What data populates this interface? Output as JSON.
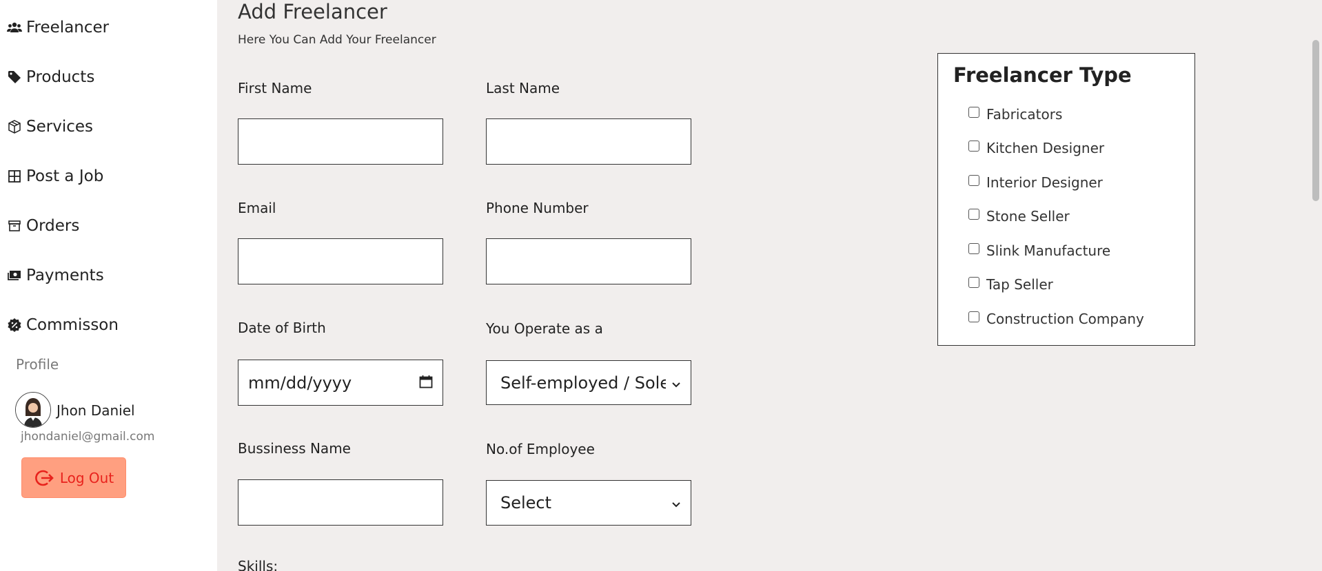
{
  "sidebar": {
    "items": [
      {
        "label": "Freelancer",
        "icon": "users-icon"
      },
      {
        "label": "Products",
        "icon": "tag-icon"
      },
      {
        "label": "Services",
        "icon": "box-icon"
      },
      {
        "label": "Post a Job",
        "icon": "grid-icon"
      },
      {
        "label": "Orders",
        "icon": "archive-icon"
      },
      {
        "label": "Payments",
        "icon": "money-icon"
      },
      {
        "label": "Commisson",
        "icon": "badge-percent-icon"
      }
    ],
    "profile_heading": "Profile",
    "user_name": "Jhon Daniel",
    "user_email": "jhondaniel@gmail.com",
    "logout_label": "Log Out"
  },
  "main": {
    "title": "Add Freelancer",
    "subtitle": "Here You Can Add Your Freelancer",
    "fields": {
      "first_name": {
        "label": "First Name",
        "value": ""
      },
      "last_name": {
        "label": "Last Name",
        "value": ""
      },
      "email": {
        "label": "Email",
        "value": ""
      },
      "phone": {
        "label": "Phone Number",
        "value": ""
      },
      "dob": {
        "label": "Date of Birth",
        "placeholder": "mm/dd/yyyy"
      },
      "operate_as": {
        "label": "You Operate as a",
        "value": "Self-employed / Sole Trader"
      },
      "business_name": {
        "label": "Bussiness Name",
        "value": ""
      },
      "employees": {
        "label": "No.of Employee",
        "value": "Select"
      }
    },
    "skills_label": "Skills:"
  },
  "freelancer_type": {
    "title": "Freelancer Type",
    "options": [
      {
        "label": "Fabricators",
        "checked": false
      },
      {
        "label": "Kitchen Designer",
        "checked": false
      },
      {
        "label": "Interior Designer",
        "checked": false
      },
      {
        "label": "Stone Seller",
        "checked": false
      },
      {
        "label": "Slink Manufacture",
        "checked": false
      },
      {
        "label": "Tap Seller",
        "checked": false
      },
      {
        "label": "Construction Company",
        "checked": false
      }
    ]
  },
  "colors": {
    "main_bg": "#f1eeed",
    "logout_bg": "#ff9f80",
    "logout_text": "#e8221c"
  }
}
